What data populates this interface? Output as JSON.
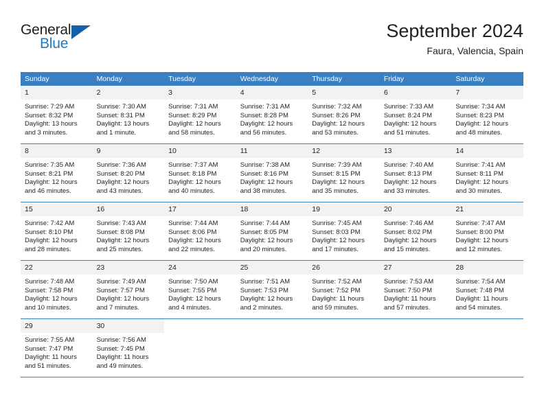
{
  "brand": {
    "name_part1": "General",
    "name_part2": "Blue"
  },
  "header": {
    "title": "September 2024",
    "subtitle": "Faura, Valencia, Spain"
  },
  "colors": {
    "header_blue": "#3a7fc1",
    "logo_blue": "#1f7ac0",
    "logo_triangle": "#1361a8",
    "daynum_band": "#f2f2f2",
    "text": "#231f20"
  },
  "weekdays": [
    "Sunday",
    "Monday",
    "Tuesday",
    "Wednesday",
    "Thursday",
    "Friday",
    "Saturday"
  ],
  "weeks": [
    [
      {
        "day": "1",
        "sunrise": "Sunrise: 7:29 AM",
        "sunset": "Sunset: 8:32 PM",
        "daylight1": "Daylight: 13 hours",
        "daylight2": "and 3 minutes."
      },
      {
        "day": "2",
        "sunrise": "Sunrise: 7:30 AM",
        "sunset": "Sunset: 8:31 PM",
        "daylight1": "Daylight: 13 hours",
        "daylight2": "and 1 minute."
      },
      {
        "day": "3",
        "sunrise": "Sunrise: 7:31 AM",
        "sunset": "Sunset: 8:29 PM",
        "daylight1": "Daylight: 12 hours",
        "daylight2": "and 58 minutes."
      },
      {
        "day": "4",
        "sunrise": "Sunrise: 7:31 AM",
        "sunset": "Sunset: 8:28 PM",
        "daylight1": "Daylight: 12 hours",
        "daylight2": "and 56 minutes."
      },
      {
        "day": "5",
        "sunrise": "Sunrise: 7:32 AM",
        "sunset": "Sunset: 8:26 PM",
        "daylight1": "Daylight: 12 hours",
        "daylight2": "and 53 minutes."
      },
      {
        "day": "6",
        "sunrise": "Sunrise: 7:33 AM",
        "sunset": "Sunset: 8:24 PM",
        "daylight1": "Daylight: 12 hours",
        "daylight2": "and 51 minutes."
      },
      {
        "day": "7",
        "sunrise": "Sunrise: 7:34 AM",
        "sunset": "Sunset: 8:23 PM",
        "daylight1": "Daylight: 12 hours",
        "daylight2": "and 48 minutes."
      }
    ],
    [
      {
        "day": "8",
        "sunrise": "Sunrise: 7:35 AM",
        "sunset": "Sunset: 8:21 PM",
        "daylight1": "Daylight: 12 hours",
        "daylight2": "and 46 minutes."
      },
      {
        "day": "9",
        "sunrise": "Sunrise: 7:36 AM",
        "sunset": "Sunset: 8:20 PM",
        "daylight1": "Daylight: 12 hours",
        "daylight2": "and 43 minutes."
      },
      {
        "day": "10",
        "sunrise": "Sunrise: 7:37 AM",
        "sunset": "Sunset: 8:18 PM",
        "daylight1": "Daylight: 12 hours",
        "daylight2": "and 40 minutes."
      },
      {
        "day": "11",
        "sunrise": "Sunrise: 7:38 AM",
        "sunset": "Sunset: 8:16 PM",
        "daylight1": "Daylight: 12 hours",
        "daylight2": "and 38 minutes."
      },
      {
        "day": "12",
        "sunrise": "Sunrise: 7:39 AM",
        "sunset": "Sunset: 8:15 PM",
        "daylight1": "Daylight: 12 hours",
        "daylight2": "and 35 minutes."
      },
      {
        "day": "13",
        "sunrise": "Sunrise: 7:40 AM",
        "sunset": "Sunset: 8:13 PM",
        "daylight1": "Daylight: 12 hours",
        "daylight2": "and 33 minutes."
      },
      {
        "day": "14",
        "sunrise": "Sunrise: 7:41 AM",
        "sunset": "Sunset: 8:11 PM",
        "daylight1": "Daylight: 12 hours",
        "daylight2": "and 30 minutes."
      }
    ],
    [
      {
        "day": "15",
        "sunrise": "Sunrise: 7:42 AM",
        "sunset": "Sunset: 8:10 PM",
        "daylight1": "Daylight: 12 hours",
        "daylight2": "and 28 minutes."
      },
      {
        "day": "16",
        "sunrise": "Sunrise: 7:43 AM",
        "sunset": "Sunset: 8:08 PM",
        "daylight1": "Daylight: 12 hours",
        "daylight2": "and 25 minutes."
      },
      {
        "day": "17",
        "sunrise": "Sunrise: 7:44 AM",
        "sunset": "Sunset: 8:06 PM",
        "daylight1": "Daylight: 12 hours",
        "daylight2": "and 22 minutes."
      },
      {
        "day": "18",
        "sunrise": "Sunrise: 7:44 AM",
        "sunset": "Sunset: 8:05 PM",
        "daylight1": "Daylight: 12 hours",
        "daylight2": "and 20 minutes."
      },
      {
        "day": "19",
        "sunrise": "Sunrise: 7:45 AM",
        "sunset": "Sunset: 8:03 PM",
        "daylight1": "Daylight: 12 hours",
        "daylight2": "and 17 minutes."
      },
      {
        "day": "20",
        "sunrise": "Sunrise: 7:46 AM",
        "sunset": "Sunset: 8:02 PM",
        "daylight1": "Daylight: 12 hours",
        "daylight2": "and 15 minutes."
      },
      {
        "day": "21",
        "sunrise": "Sunrise: 7:47 AM",
        "sunset": "Sunset: 8:00 PM",
        "daylight1": "Daylight: 12 hours",
        "daylight2": "and 12 minutes."
      }
    ],
    [
      {
        "day": "22",
        "sunrise": "Sunrise: 7:48 AM",
        "sunset": "Sunset: 7:58 PM",
        "daylight1": "Daylight: 12 hours",
        "daylight2": "and 10 minutes."
      },
      {
        "day": "23",
        "sunrise": "Sunrise: 7:49 AM",
        "sunset": "Sunset: 7:57 PM",
        "daylight1": "Daylight: 12 hours",
        "daylight2": "and 7 minutes."
      },
      {
        "day": "24",
        "sunrise": "Sunrise: 7:50 AM",
        "sunset": "Sunset: 7:55 PM",
        "daylight1": "Daylight: 12 hours",
        "daylight2": "and 4 minutes."
      },
      {
        "day": "25",
        "sunrise": "Sunrise: 7:51 AM",
        "sunset": "Sunset: 7:53 PM",
        "daylight1": "Daylight: 12 hours",
        "daylight2": "and 2 minutes."
      },
      {
        "day": "26",
        "sunrise": "Sunrise: 7:52 AM",
        "sunset": "Sunset: 7:52 PM",
        "daylight1": "Daylight: 11 hours",
        "daylight2": "and 59 minutes."
      },
      {
        "day": "27",
        "sunrise": "Sunrise: 7:53 AM",
        "sunset": "Sunset: 7:50 PM",
        "daylight1": "Daylight: 11 hours",
        "daylight2": "and 57 minutes."
      },
      {
        "day": "28",
        "sunrise": "Sunrise: 7:54 AM",
        "sunset": "Sunset: 7:48 PM",
        "daylight1": "Daylight: 11 hours",
        "daylight2": "and 54 minutes."
      }
    ],
    [
      {
        "day": "29",
        "sunrise": "Sunrise: 7:55 AM",
        "sunset": "Sunset: 7:47 PM",
        "daylight1": "Daylight: 11 hours",
        "daylight2": "and 51 minutes."
      },
      {
        "day": "30",
        "sunrise": "Sunrise: 7:56 AM",
        "sunset": "Sunset: 7:45 PM",
        "daylight1": "Daylight: 11 hours",
        "daylight2": "and 49 minutes."
      },
      {
        "day": "",
        "sunrise": "",
        "sunset": "",
        "daylight1": "",
        "daylight2": ""
      },
      {
        "day": "",
        "sunrise": "",
        "sunset": "",
        "daylight1": "",
        "daylight2": ""
      },
      {
        "day": "",
        "sunrise": "",
        "sunset": "",
        "daylight1": "",
        "daylight2": ""
      },
      {
        "day": "",
        "sunrise": "",
        "sunset": "",
        "daylight1": "",
        "daylight2": ""
      },
      {
        "day": "",
        "sunrise": "",
        "sunset": "",
        "daylight1": "",
        "daylight2": ""
      }
    ]
  ]
}
